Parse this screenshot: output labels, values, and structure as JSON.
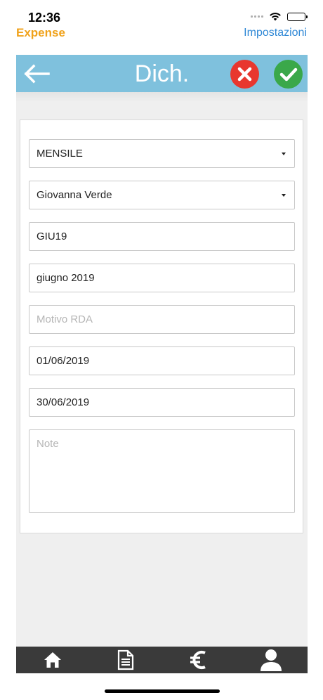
{
  "status_bar": {
    "time": "12:36",
    "icons": [
      "cellular-signal-icon",
      "wifi-icon",
      "battery-icon"
    ]
  },
  "top_links": {
    "back_app": "Expense",
    "settings": "Impostazioni"
  },
  "header": {
    "title": "Dich.",
    "back_icon": "arrow-left-icon",
    "cancel_icon": "close-icon",
    "confirm_icon": "checkmark-icon"
  },
  "form": {
    "period_type": "MENSILE",
    "employee": "Giovanna Verde",
    "code": "GIU19",
    "description": "giugno 2019",
    "reason_placeholder": "Motivo RDA",
    "start_date": "01/06/2019",
    "end_date": "30/06/2019",
    "notes_placeholder": "Note"
  },
  "tab_bar": {
    "tabs": [
      "home-icon",
      "document-icon",
      "euro-icon",
      "user-icon"
    ]
  },
  "colors": {
    "header_bg": "#7fc1dd",
    "back_app_text": "#f0a21b",
    "settings_text": "#2f88d6",
    "cancel_button": "#e8372f",
    "confirm_button": "#3aa84a",
    "tab_bar_bg": "#3a3a3a"
  }
}
